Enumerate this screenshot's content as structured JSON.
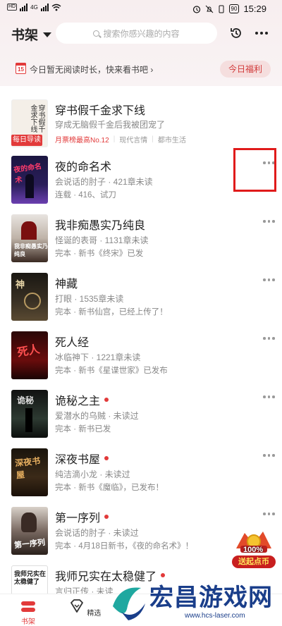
{
  "status": {
    "time": "15:29",
    "battery": "90",
    "net": "4G"
  },
  "header": {
    "title": "书架",
    "search_placeholder": "搜索你感兴趣的内容"
  },
  "notice": {
    "day": "15",
    "text": "今日暂无阅读时长，快来看书吧 ›",
    "button": "今日福利"
  },
  "featured": {
    "title": "穿书假千金求下线",
    "desc": "穿成无脑假千金后我被团宠了",
    "rank": "月票榜最高No.12",
    "tag1": "现代言情",
    "tag2": "都市生活",
    "badge": "每日导读",
    "cover_text": "穿书假千金求下线"
  },
  "books": [
    {
      "title": "夜的命名术",
      "line1": "会说话的肘子 · 421章未读",
      "line2": "连载 · 416、试刀",
      "dot": false
    },
    {
      "title": "我非痴愚实乃纯良",
      "line1": "怪诞的表哥 · 1131章未读",
      "line2": "完本 · 新书《终宋》已发",
      "dot": false
    },
    {
      "title": "神藏",
      "line1": "打眼 · 1535章未读",
      "line2": "完本 · 新书仙宫，已经上传了！",
      "dot": false
    },
    {
      "title": "死人经",
      "line1": "冰临神下 · 1221章未读",
      "line2": "完本 · 新书《星谍世家》已发布",
      "dot": false
    },
    {
      "title": "诡秘之主",
      "line1": "爱潜水的乌贼 · 未读过",
      "line2": "完本 · 新书已发",
      "dot": true
    },
    {
      "title": "深夜书屋",
      "line1": "纯洁滴小龙 · 未读过",
      "line2": "完本 · 新书《魔临》，已发布！",
      "dot": true
    },
    {
      "title": "第一序列",
      "line1": "会说话的肘子 · 未读过",
      "line2": "完本 · 4月18日新书，《夜的命名术》！",
      "dot": true
    },
    {
      "title": "我师兄实在太稳健了",
      "line1": "言归正传 · 未读",
      "line2": "",
      "dot": true
    }
  ],
  "coin_widget": {
    "pct": "100%",
    "label": "送起点币"
  },
  "nav": {
    "shelf": "书架",
    "pick": "精选"
  },
  "watermark": {
    "text": "宏昌游戏网",
    "url": "www.hcs-laser.com"
  },
  "colors": {
    "accent": "#e23a3a",
    "highlight": "#e01b1b"
  }
}
